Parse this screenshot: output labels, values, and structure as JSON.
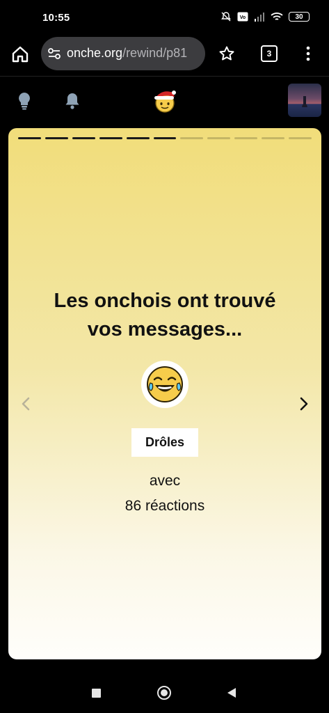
{
  "statusbar": {
    "time": "10:55",
    "battery": "30"
  },
  "browser": {
    "url_host": "onche.org",
    "url_path": "/rewind/p81",
    "tab_count": "3"
  },
  "site_nav": {
    "icons": [
      "lightbulb-icon",
      "bell-icon",
      "santa-mascot-icon",
      "user-avatar"
    ]
  },
  "story": {
    "progress_total": 11,
    "progress_done": 6,
    "title": "Les onchois ont trouvé vos messages...",
    "emoji": "laughing-tears-emoji",
    "category": "Drôles",
    "with_label": "avec",
    "reaction_count": "86",
    "reaction_label": "réactions"
  },
  "colors": {
    "card_top": "#f1dd7a",
    "card_bottom": "#fffefb",
    "background": "#000000"
  }
}
